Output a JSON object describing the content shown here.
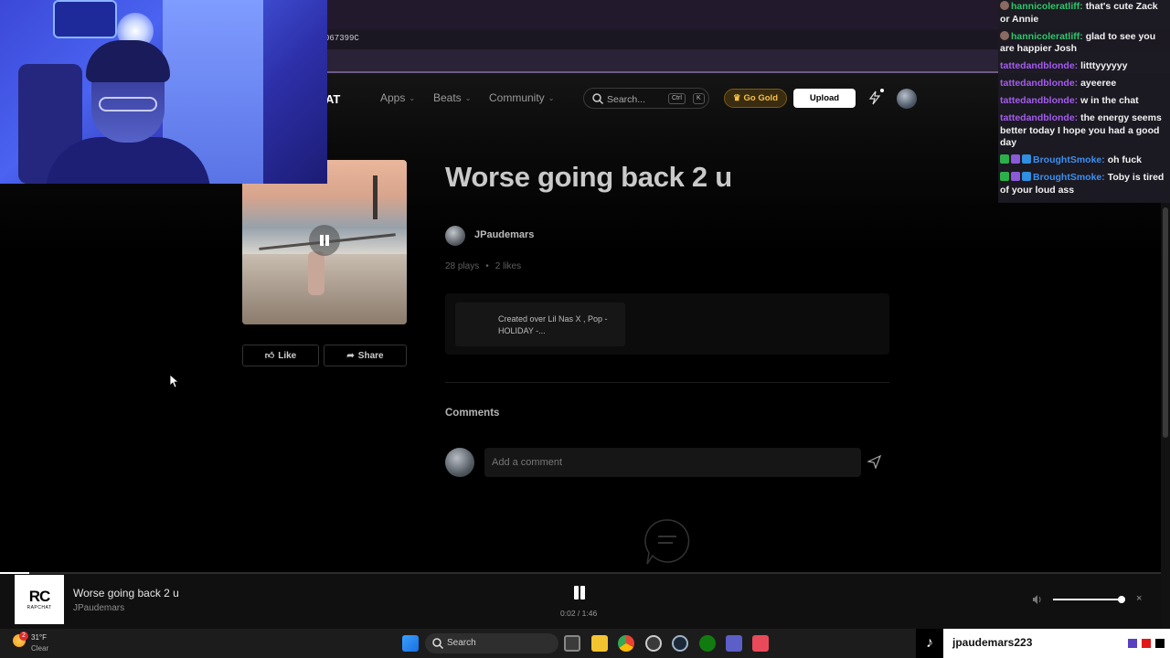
{
  "browser": {
    "url_fragment": "067399C"
  },
  "nav": {
    "logo_fragment": "AT",
    "apps": "Apps",
    "beats": "Beats",
    "community": "Community",
    "search_placeholder": "Search...",
    "shortcut_mod": "Ctrl",
    "shortcut_key": "K",
    "go_gold": "Go Gold",
    "upload": "Upload"
  },
  "track": {
    "title": "Worse going back 2 u",
    "artist": "JPaudemars",
    "plays": "28 plays",
    "likes": "2 likes",
    "description": "Created over Lil Nas X , Pop - HOLIDAY -..."
  },
  "actions": {
    "like": "Like",
    "share": "Share"
  },
  "comments": {
    "heading": "Comments",
    "placeholder": "Add a comment"
  },
  "player": {
    "logo": "RC",
    "logo_sub": "RAPCHAT",
    "title": "Worse going back 2 u",
    "artist": "JPaudemars",
    "time": "0:02 / 1:46",
    "progress": 0.02,
    "volume": 0.99,
    "close": "×"
  },
  "chat": [
    {
      "user": "hannicoleratliff",
      "color": "#2ec86a",
      "badge": "grey",
      "text": "that's cute Zack or Annie"
    },
    {
      "user": "hannicoleratliff",
      "color": "#2ec86a",
      "badge": "grey",
      "text": "glad to see you are happier Josh"
    },
    {
      "user": "tattedandblonde",
      "color": "#a45cf0",
      "badge": "",
      "text": "litttyyyyyy"
    },
    {
      "user": "tattedandblonde",
      "color": "#a45cf0",
      "badge": "",
      "text": "ayeeree"
    },
    {
      "user": "tattedandblonde",
      "color": "#a45cf0",
      "badge": "",
      "text": "w in the chat"
    },
    {
      "user": "tattedandblonde",
      "color": "#a45cf0",
      "badge": "",
      "text": "the energy seems better today I hope you had a good day"
    },
    {
      "user": "BroughtSmoke",
      "color": "#3d8ff0",
      "badge": "multi",
      "text": "oh fuck"
    },
    {
      "user": "BroughtSmoke",
      "color": "#3d8ff0",
      "badge": "multi",
      "text": "Toby is tired of your loud ass"
    }
  ],
  "taskbar": {
    "weather_badge": "2",
    "temp": "31°F",
    "condition": "Clear",
    "search": "Search",
    "icons": [
      "start-icon",
      "task-view-icon",
      "file-explorer-icon",
      "chrome-icon",
      "obs-icon",
      "steam-icon",
      "xbox-icon",
      "grid-app-icon",
      "rapchat-app-icon"
    ]
  },
  "tiktok": {
    "username": "jpaudemars223"
  },
  "colors": {
    "accent_gold": "#f6c147",
    "page_bg": "#000000"
  }
}
